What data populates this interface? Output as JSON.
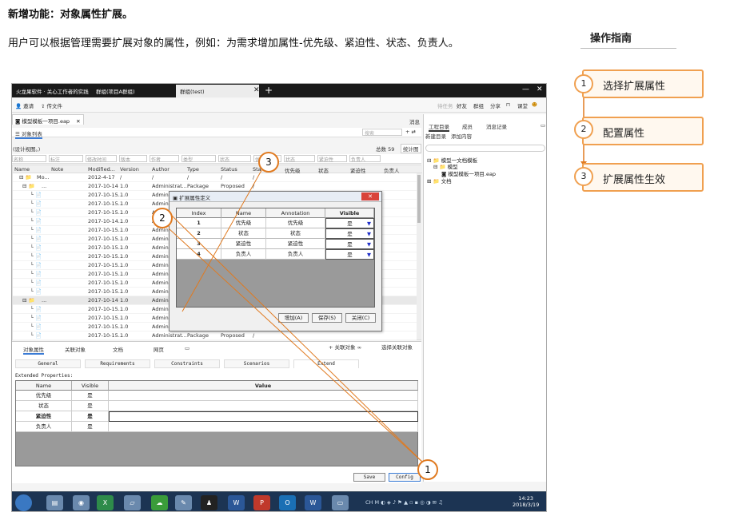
{
  "header": {
    "title": "新增功能：对象属性扩展。",
    "description": "用户可以根据管理需要扩展对象的属性，例如：为需求增加属性-优先级、紧迫性、状态、负责人。"
  },
  "guide": {
    "title": "操作指南",
    "steps": [
      {
        "num": "1",
        "label": "选择扩展属性"
      },
      {
        "num": "2",
        "label": "配置属性"
      },
      {
        "num": "3",
        "label": "扩展属性生效"
      }
    ]
  },
  "screenshot": {
    "browser_tabs": [
      "火龙果软件 · 关心工作者的实践",
      "群组(项目A群组)",
      "群组(test)"
    ],
    "toolbar": {
      "messages": "邀请",
      "file": "传文件",
      "right": [
        "消息",
        "好友",
        "群组",
        "分享",
        "课堂"
      ],
      "faded": "待任务"
    },
    "doc_tab": "模型模板一项目.eap",
    "list_tab": "对象列表",
    "design_view": "(设计视图。)",
    "total": "总数 59",
    "stats": "统计图",
    "search_placeholder": "搜索",
    "right_panel": {
      "header": "消息",
      "tabs": [
        "工程目录",
        "成员",
        "消息记录"
      ],
      "actions": [
        "新建目录",
        "添加内容"
      ],
      "tree": [
        "模型一文档模板",
        "模型",
        "模型模板一项目.eap",
        "文档"
      ]
    },
    "filters": [
      "名称",
      "标注",
      "修改时间",
      "版本",
      "作者",
      "类型",
      "状态",
      "优先级",
      "状态",
      "紧迫性",
      "负责人"
    ],
    "columns": [
      "Name",
      "Note",
      "Modified...",
      "Version",
      "Author",
      "Type",
      "Status",
      "Sta",
      "优先级",
      "状态",
      "紧迫性",
      "负责人"
    ],
    "rows": [
      {
        "name": "Mo...",
        "date": "2012-4-17",
        "ver": "/",
        "author": "/",
        "type": "/",
        "status": "/",
        "extra": "/"
      },
      {
        "name": "...",
        "date": "2017-10-14",
        "ver": "1.0",
        "author": "Administrat...",
        "type": "Package",
        "status": "Proposed",
        "extra": "/"
      },
      {
        "name": "",
        "date": "2017-10-15...",
        "ver": "1.0",
        "author": "Administrat...",
        "type": "",
        "status": "",
        "extra": ""
      },
      {
        "name": "",
        "date": "2017-10-15...",
        "ver": "1.0",
        "author": "Admin",
        "type": "",
        "status": "",
        "extra": ""
      },
      {
        "name": "",
        "date": "2017-10-15...",
        "ver": "1.0",
        "author": "Admin",
        "type": "",
        "status": "",
        "extra": ""
      },
      {
        "name": "",
        "date": "2017-10-14...",
        "ver": "1.0",
        "author": "Admin",
        "type": "",
        "status": "",
        "extra": ""
      },
      {
        "name": "",
        "date": "2017-10-15...",
        "ver": "1.0",
        "author": "Admin",
        "type": "",
        "status": "",
        "extra": ""
      },
      {
        "name": "",
        "date": "2017-10-15...",
        "ver": "1.0",
        "author": "Admin",
        "type": "",
        "status": "",
        "extra": ""
      },
      {
        "name": "",
        "date": "2017-10-15...",
        "ver": "1.0",
        "author": "Admin",
        "type": "",
        "status": "",
        "extra": ""
      },
      {
        "name": "",
        "date": "2017-10-15...",
        "ver": "1.0",
        "author": "Admin",
        "type": "",
        "status": "",
        "extra": ""
      },
      {
        "name": "",
        "date": "2017-10-15...",
        "ver": "1.0",
        "author": "Admin",
        "type": "",
        "status": "",
        "extra": ""
      },
      {
        "name": "",
        "date": "2017-10-15...",
        "ver": "1.0",
        "author": "Admin",
        "type": "",
        "status": "",
        "extra": ""
      },
      {
        "name": "",
        "date": "2017-10-15...",
        "ver": "1.0",
        "author": "Admin",
        "type": "",
        "status": "",
        "extra": ""
      },
      {
        "name": "",
        "date": "2017-10-15...",
        "ver": "1.0",
        "author": "Admin",
        "type": "",
        "status": "",
        "extra": ""
      },
      {
        "name": "...",
        "date": "2017-10-14",
        "ver": "1.0",
        "author": "Admin",
        "type": "",
        "status": "",
        "extra": ""
      },
      {
        "name": "",
        "date": "2017-10-15...",
        "ver": "1.0",
        "author": "Admin",
        "type": "",
        "status": "",
        "extra": ""
      },
      {
        "name": "",
        "date": "2017-10-15...",
        "ver": "1.0",
        "author": "Admin",
        "type": "",
        "status": "",
        "extra": ""
      },
      {
        "name": "",
        "date": "2017-10-15...",
        "ver": "1.0",
        "author": "Admin",
        "type": "",
        "status": "",
        "extra": ""
      },
      {
        "name": "",
        "date": "2017-10-15...",
        "ver": "1.0",
        "author": "Administrat...",
        "type": "Package",
        "status": "Proposed",
        "extra": "/"
      }
    ],
    "dialog": {
      "title": "扩展属性定义",
      "headers": [
        "Index",
        "Name",
        "Annotation",
        "Visible"
      ],
      "rows": [
        {
          "index": "1",
          "name": "优先级",
          "annotation": "优先级",
          "visible": "是"
        },
        {
          "index": "2",
          "name": "状态",
          "annotation": "状态",
          "visible": "是"
        },
        {
          "index": "3",
          "name": "紧迫性",
          "annotation": "紧迫性",
          "visible": "是"
        },
        {
          "index": "4",
          "name": "负责人",
          "annotation": "负责人",
          "visible": "是"
        }
      ],
      "buttons": [
        "增加(A)",
        "保存(S)",
        "关闭(C)"
      ]
    },
    "bottom": {
      "tabs": [
        "对象属性",
        "关联对象",
        "文档",
        "网页"
      ],
      "right_actions": [
        "关联对象",
        "选择关联对象"
      ],
      "subtabs": [
        "General",
        "Requirements",
        "Constraints",
        "Scenarios",
        "Extend"
      ],
      "ext_label": "Extended Properties:",
      "headers": [
        "Name",
        "Visible",
        "Value"
      ],
      "rows": [
        {
          "name": "优先级",
          "visible": "是"
        },
        {
          "name": "状态",
          "visible": "是"
        },
        {
          "name": "紧迫性",
          "visible": "是"
        },
        {
          "name": "负责人",
          "visible": "是"
        }
      ],
      "save": "Save",
      "config": "Config"
    },
    "clock": {
      "time": "14:23",
      "date": "2018/3/19"
    }
  },
  "callouts": [
    "1",
    "2",
    "3"
  ],
  "colors": {
    "accent": "#e07a20",
    "guide_border": "#f0a050"
  }
}
